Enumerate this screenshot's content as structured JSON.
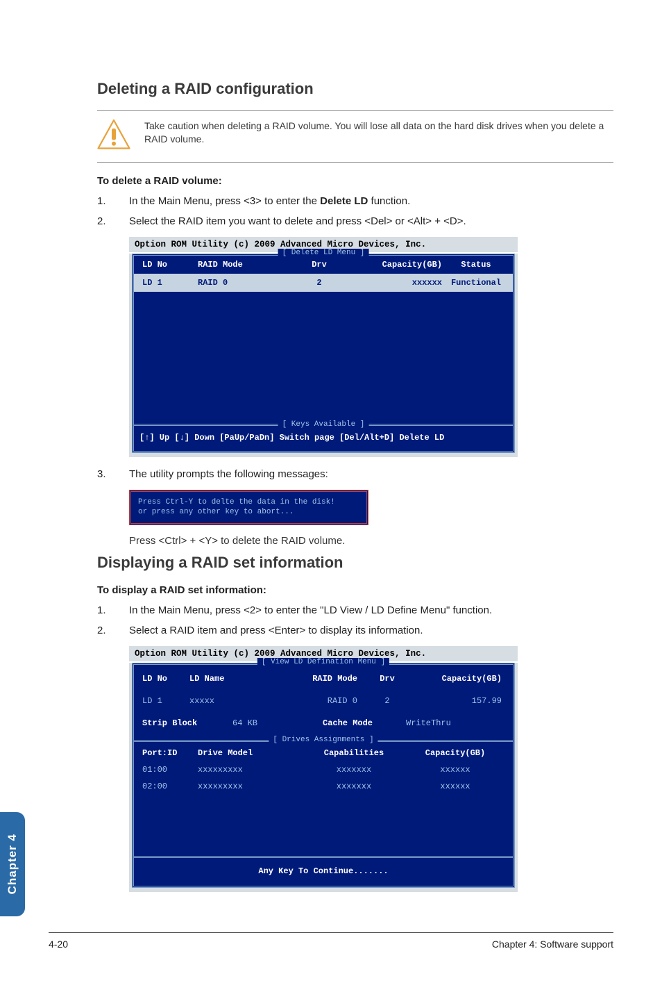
{
  "section1": {
    "title": "Deleting a RAID configuration",
    "caution_text": "Take caution when deleting a RAID volume. You will lose all data on the hard disk drives when you delete a RAID volume.",
    "bold_para": "To delete a RAID volume:",
    "step1_num": "1.",
    "step1_text_a": "In the Main Menu, press <3> to enter the ",
    "step1_text_bold": "Delete LD",
    "step1_text_b": " function.",
    "step2_num": "2.",
    "step2_text": "Select the RAID item you want to delete and press <Del> or <Alt> + <D>."
  },
  "bios1": {
    "header": "Option ROM Utility (c) 2009 Advanced Micro Devices, Inc.",
    "panel_title": "[ Delete LD Menu ]",
    "columns": {
      "ldno": "LD No",
      "mode": "RAID Mode",
      "drv": "Drv",
      "cap": "Capacity(GB)",
      "stat": "Status"
    },
    "row": {
      "ldno": "LD  1",
      "mode": "RAID 0",
      "drv": "2",
      "cap": "xxxxxx",
      "stat": "Functional"
    },
    "keys_title": "[ Keys Available ]",
    "keys_text": "[↑] Up  [↓] Down  [PaUp/PaDn] Switch page  [Del/Alt+D] Delete LD"
  },
  "step3": {
    "num": "3.",
    "text": "The utility prompts the following messages:",
    "redbox_line1": "Press Ctrl-Y to delte the data in the disk!",
    "redbox_line2": "or press any other key to abort...",
    "after": "Press <Ctrl> + <Y> to delete the RAID volume."
  },
  "section2": {
    "title": "Displaying a RAID set information",
    "bold_para": "To display a RAID set information:",
    "step1_num": "1.",
    "step1_text": "In the Main Menu, press <2> to enter the \"LD View / LD Define Menu\" function.",
    "step2_num": "2.",
    "step2_text": "Select a RAID item and press <Enter> to display its information."
  },
  "bios2": {
    "header": "Option ROM Utility (c) 2009 Advanced Micro Devices, Inc.",
    "panel_title": "[ View LD Defination Menu ]",
    "top_headers": {
      "c1": "LD No",
      "c2": "LD Name",
      "c3": "RAID Mode",
      "c4": "Drv",
      "c5": "Capacity(GB)"
    },
    "top_row": {
      "c1": "LD  1",
      "c2": "xxxxx",
      "c3": "RAID 0",
      "c4": "2",
      "c5": "157.99"
    },
    "strip": {
      "s1": "Strip Block",
      "s2": "64 KB",
      "s3": "Cache Mode",
      "s4": "WriteThru"
    },
    "drives_title": "[ Drives Assignments ]",
    "drives_headers": {
      "d1": "Port:ID",
      "d2": "Drive Model",
      "d3": "Capabilities",
      "d4": "Capacity(GB)"
    },
    "drives_rows": [
      {
        "d1": "01:00",
        "d2": "xxxxxxxxx",
        "d3": "xxxxxxx",
        "d4": "xxxxxx"
      },
      {
        "d1": "02:00",
        "d2": "xxxxxxxxx",
        "d3": "xxxxxxx",
        "d4": "xxxxxx"
      }
    ],
    "continue": "Any Key To Continue......."
  },
  "side_tab": "Chapter 4",
  "footer": {
    "left": "4-20",
    "right": "Chapter 4: Software support"
  }
}
